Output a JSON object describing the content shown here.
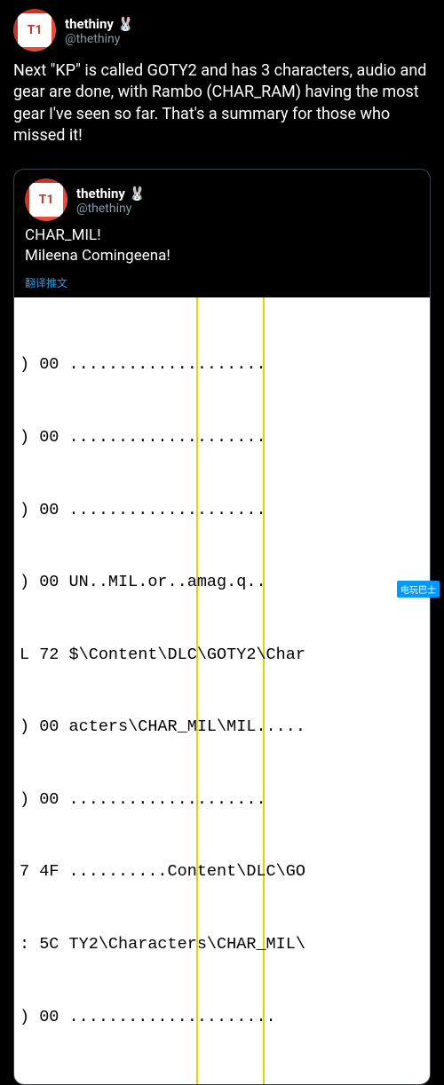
{
  "tweet1": {
    "avatar_text": "T1",
    "display_name": "thethiny",
    "rabbit_emoji": "🐰",
    "handle": "@thethiny",
    "body": "Next \"KP\" is called GOTY2 and has 3 characters, audio and gear are done, with Rambo (CHAR_RAM) having the most gear I've seen so far. That's a summary for those who missed it!"
  },
  "tweet2": {
    "avatar_text": "T1",
    "display_name": "thethiny",
    "rabbit_emoji": "🐰",
    "handle": "@thethiny",
    "body_line1": "CHAR_MIL!",
    "body_line2": "Mileena Comingeena!",
    "translate": "翻译推文"
  },
  "hex": {
    "row1": ") 00 ....................",
    "row2": ") 00 ....................",
    "row3": ") 00 ....................",
    "row4": ") 00 UN..MIL.or..amag.q..",
    "row5": "L 72 $\\Content\\DLC\\GOTY2\\Char",
    "row6": ") 00 acters\\CHAR_MIL\\MIL.....",
    "row7": ") 00 ....................",
    "row8": "7 4F ..........Content\\DLC\\GO",
    "row9": ": 5C TY2\\Characters\\CHAR_MIL\\",
    "row10": ") 00 ....................."
  },
  "watermark": "电玩巴士"
}
